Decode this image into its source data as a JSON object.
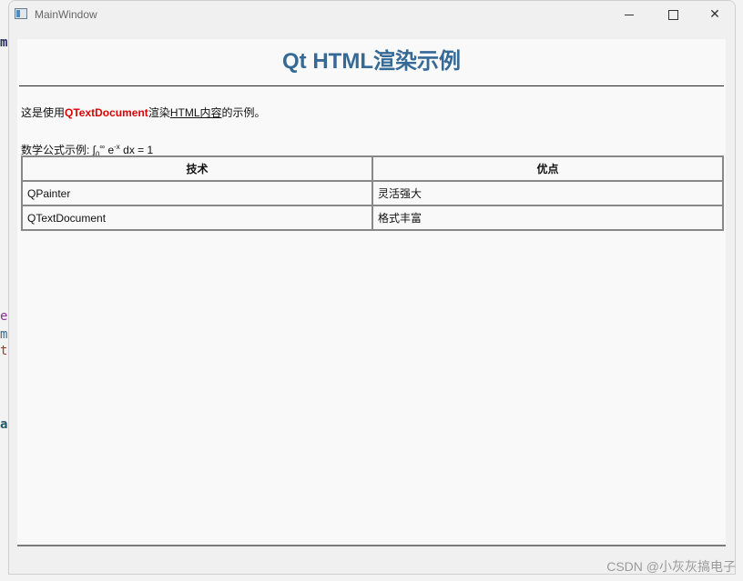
{
  "window": {
    "title": "MainWindow",
    "minimize_glyph": "",
    "maximize_glyph": "",
    "close_glyph": "✕"
  },
  "document": {
    "title": "Qt HTML渲染示例",
    "intro_prefix": "这是使用",
    "intro_highlight": "QTextDocument",
    "intro_mid": "渲染",
    "intro_underline": "HTML内容",
    "intro_suffix": "的示例。",
    "formula_label": "数学公式示例: ",
    "formula_integral": "∫",
    "formula_sub": "0",
    "formula_sup": "∞",
    "formula_e": " e",
    "formula_exp": "-x",
    "formula_rest": " dx = 1",
    "table": {
      "headers": [
        "技术",
        "优点"
      ],
      "rows": [
        [
          "QPainter",
          "灵活强大"
        ],
        [
          "QTextDocument",
          "格式丰富"
        ]
      ]
    }
  },
  "watermark": "CSDN @小灰灰搞电子",
  "background_fragments": [
    "m",
    "e",
    "m",
    "t",
    "a"
  ],
  "colors": {
    "title": "#356a96",
    "highlight": "#e00000"
  }
}
